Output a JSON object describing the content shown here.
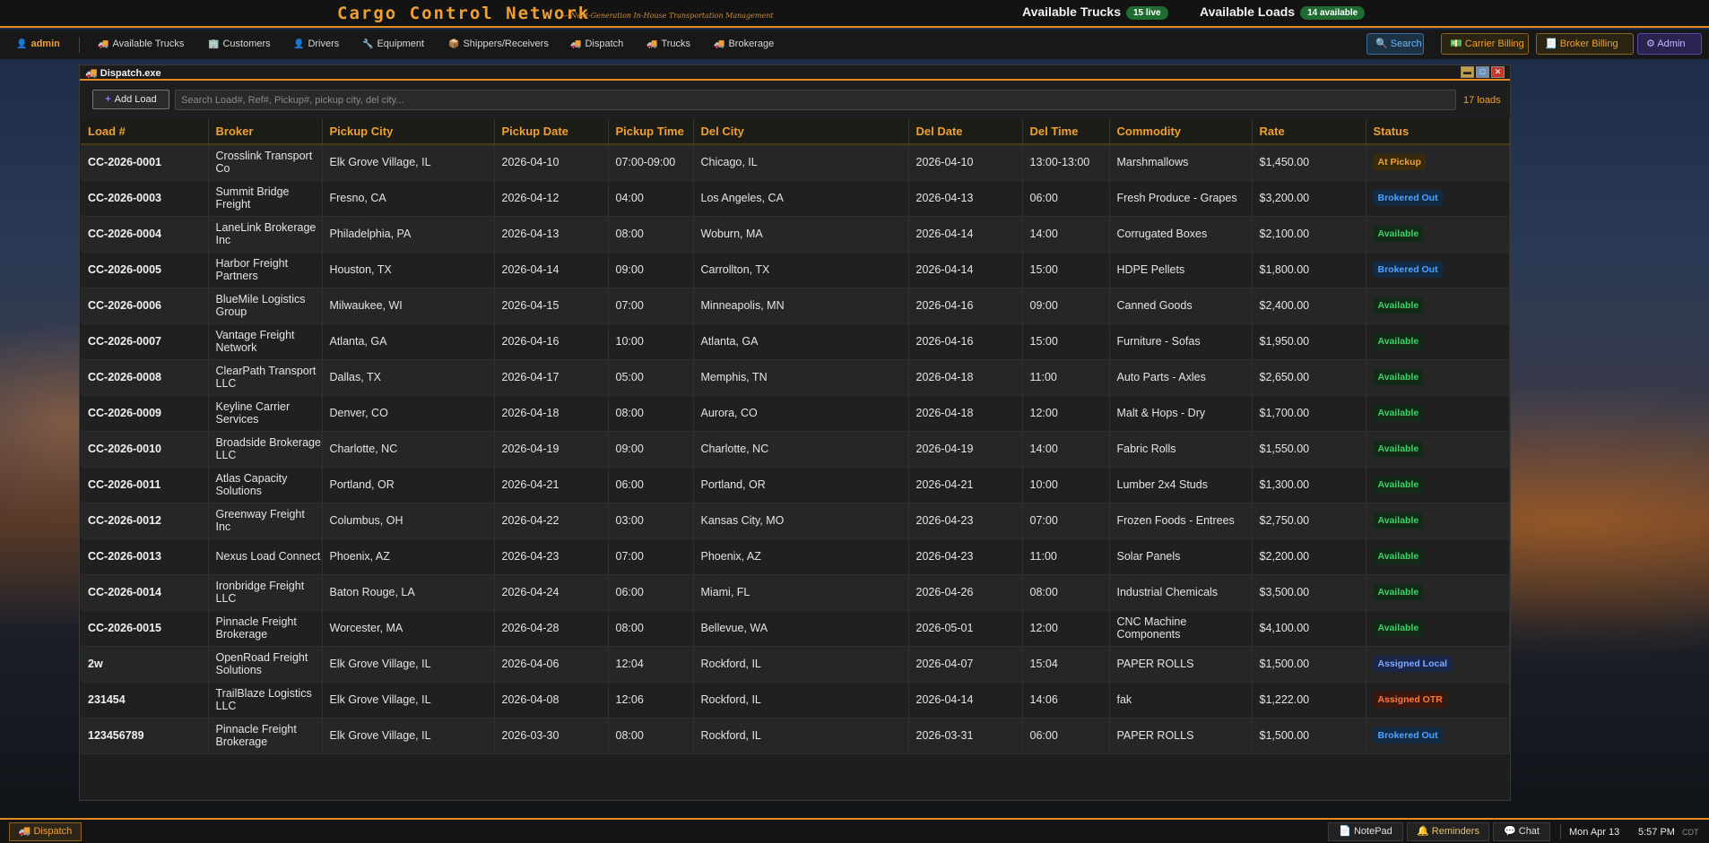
{
  "header": {
    "title": "Cargo Control Network",
    "tagline": "— Next-Generation In-House Transportation Management",
    "available_trucks_label": "Available Trucks",
    "available_trucks_badge": "15 live",
    "available_loads_label": "Available Loads",
    "available_loads_badge": "14 available"
  },
  "nav": {
    "user": "admin",
    "items": [
      {
        "label": "Available Trucks",
        "icon": "truck-icon"
      },
      {
        "label": "Customers",
        "icon": "building-icon"
      },
      {
        "label": "Drivers",
        "icon": "person-icon"
      },
      {
        "label": "Equipment",
        "icon": "wrench-icon"
      },
      {
        "label": "Shippers/Receivers",
        "icon": "box-icon"
      },
      {
        "label": "Dispatch",
        "icon": "truck-icon"
      },
      {
        "label": "Trucks",
        "icon": "truck-icon"
      },
      {
        "label": "Brokerage",
        "icon": "truck-icon"
      }
    ],
    "right_buttons": {
      "search": "Search",
      "carrier_billing": "Carrier Billing",
      "broker_billing": "Broker Billing",
      "admin": "Admin"
    }
  },
  "window": {
    "title": "Dispatch.exe",
    "add_load_label": "Add Load",
    "search_placeholder": "Search Load#, Ref#, Pickup#, pickup city, del city...",
    "load_count": "17 loads",
    "columns": [
      "Load #",
      "Broker",
      "Pickup City",
      "Pickup Date",
      "Pickup Time",
      "Del City",
      "Del Date",
      "Del Time",
      "Commodity",
      "Rate",
      "Status"
    ],
    "rows": [
      {
        "load": "CC-2026-0001",
        "broker": "Crosslink Transport Co",
        "pickup_city": "Elk Grove Village, IL",
        "pickup_date": "2026-04-10",
        "pickup_time": "07:00-09:00",
        "del_city": "Chicago, IL",
        "del_date": "2026-04-10",
        "del_time": "13:00-13:00",
        "commodity": "Marshmallows",
        "rate": "$1,450.00",
        "status": "At Pickup",
        "status_class": "st-pickup"
      },
      {
        "load": "CC-2026-0003",
        "broker": "Summit Bridge Freight",
        "pickup_city": "Fresno, CA",
        "pickup_date": "2026-04-12",
        "pickup_time": "04:00",
        "del_city": "Los Angeles, CA",
        "del_date": "2026-04-13",
        "del_time": "06:00",
        "commodity": "Fresh Produce - Grapes",
        "rate": "$3,200.00",
        "status": "Brokered Out",
        "status_class": "st-brokered"
      },
      {
        "load": "CC-2026-0004",
        "broker": "LaneLink Brokerage Inc",
        "pickup_city": "Philadelphia, PA",
        "pickup_date": "2026-04-13",
        "pickup_time": "08:00",
        "del_city": "Woburn, MA",
        "del_date": "2026-04-14",
        "del_time": "14:00",
        "commodity": "Corrugated Boxes",
        "rate": "$2,100.00",
        "status": "Available",
        "status_class": "st-available"
      },
      {
        "load": "CC-2026-0005",
        "broker": "Harbor Freight Partners",
        "pickup_city": "Houston, TX",
        "pickup_date": "2026-04-14",
        "pickup_time": "09:00",
        "del_city": "Carrollton, TX",
        "del_date": "2026-04-14",
        "del_time": "15:00",
        "commodity": "HDPE Pellets",
        "rate": "$1,800.00",
        "status": "Brokered Out",
        "status_class": "st-brokered"
      },
      {
        "load": "CC-2026-0006",
        "broker": "BlueMile Logistics Group",
        "pickup_city": "Milwaukee, WI",
        "pickup_date": "2026-04-15",
        "pickup_time": "07:00",
        "del_city": "Minneapolis, MN",
        "del_date": "2026-04-16",
        "del_time": "09:00",
        "commodity": "Canned Goods",
        "rate": "$2,400.00",
        "status": "Available",
        "status_class": "st-available"
      },
      {
        "load": "CC-2026-0007",
        "broker": "Vantage Freight Network",
        "pickup_city": "Atlanta, GA",
        "pickup_date": "2026-04-16",
        "pickup_time": "10:00",
        "del_city": "Atlanta, GA",
        "del_date": "2026-04-16",
        "del_time": "15:00",
        "commodity": "Furniture - Sofas",
        "rate": "$1,950.00",
        "status": "Available",
        "status_class": "st-available"
      },
      {
        "load": "CC-2026-0008",
        "broker": "ClearPath Transport LLC",
        "pickup_city": "Dallas, TX",
        "pickup_date": "2026-04-17",
        "pickup_time": "05:00",
        "del_city": "Memphis, TN",
        "del_date": "2026-04-18",
        "del_time": "11:00",
        "commodity": "Auto Parts - Axles",
        "rate": "$2,650.00",
        "status": "Available",
        "status_class": "st-available"
      },
      {
        "load": "CC-2026-0009",
        "broker": "Keyline Carrier Services",
        "pickup_city": "Denver, CO",
        "pickup_date": "2026-04-18",
        "pickup_time": "08:00",
        "del_city": "Aurora, CO",
        "del_date": "2026-04-18",
        "del_time": "12:00",
        "commodity": "Malt & Hops - Dry",
        "rate": "$1,700.00",
        "status": "Available",
        "status_class": "st-available"
      },
      {
        "load": "CC-2026-0010",
        "broker": "Broadside Brokerage LLC",
        "pickup_city": "Charlotte, NC",
        "pickup_date": "2026-04-19",
        "pickup_time": "09:00",
        "del_city": "Charlotte, NC",
        "del_date": "2026-04-19",
        "del_time": "14:00",
        "commodity": "Fabric Rolls",
        "rate": "$1,550.00",
        "status": "Available",
        "status_class": "st-available"
      },
      {
        "load": "CC-2026-0011",
        "broker": "Atlas Capacity Solutions",
        "pickup_city": "Portland, OR",
        "pickup_date": "2026-04-21",
        "pickup_time": "06:00",
        "del_city": "Portland, OR",
        "del_date": "2026-04-21",
        "del_time": "10:00",
        "commodity": "Lumber 2x4 Studs",
        "rate": "$1,300.00",
        "status": "Available",
        "status_class": "st-available"
      },
      {
        "load": "CC-2026-0012",
        "broker": "Greenway Freight Inc",
        "pickup_city": "Columbus, OH",
        "pickup_date": "2026-04-22",
        "pickup_time": "03:00",
        "del_city": "Kansas City, MO",
        "del_date": "2026-04-23",
        "del_time": "07:00",
        "commodity": "Frozen Foods - Entrees",
        "rate": "$2,750.00",
        "status": "Available",
        "status_class": "st-available"
      },
      {
        "load": "CC-2026-0013",
        "broker": "Nexus Load Connect",
        "pickup_city": "Phoenix, AZ",
        "pickup_date": "2026-04-23",
        "pickup_time": "07:00",
        "del_city": "Phoenix, AZ",
        "del_date": "2026-04-23",
        "del_time": "11:00",
        "commodity": "Solar Panels",
        "rate": "$2,200.00",
        "status": "Available",
        "status_class": "st-available"
      },
      {
        "load": "CC-2026-0014",
        "broker": "Ironbridge Freight LLC",
        "pickup_city": "Baton Rouge, LA",
        "pickup_date": "2026-04-24",
        "pickup_time": "06:00",
        "del_city": "Miami, FL",
        "del_date": "2026-04-26",
        "del_time": "08:00",
        "commodity": "Industrial Chemicals",
        "rate": "$3,500.00",
        "status": "Available",
        "status_class": "st-available"
      },
      {
        "load": "CC-2026-0015",
        "broker": "Pinnacle Freight Brokerage",
        "pickup_city": "Worcester, MA",
        "pickup_date": "2026-04-28",
        "pickup_time": "08:00",
        "del_city": "Bellevue, WA",
        "del_date": "2026-05-01",
        "del_time": "12:00",
        "commodity": "CNC Machine Components",
        "rate": "$4,100.00",
        "status": "Available",
        "status_class": "st-available"
      },
      {
        "load": "2w",
        "broker": "OpenRoad Freight Solutions",
        "pickup_city": "Elk Grove Village, IL",
        "pickup_date": "2026-04-06",
        "pickup_time": "12:04",
        "del_city": "Rockford, IL",
        "del_date": "2026-04-07",
        "del_time": "15:04",
        "commodity": "PAPER ROLLS",
        "rate": "$1,500.00",
        "status": "Assigned Local",
        "status_class": "st-local"
      },
      {
        "load": "231454",
        "broker": "TrailBlaze Logistics LLC",
        "pickup_city": "Elk Grove Village, IL",
        "pickup_date": "2026-04-08",
        "pickup_time": "12:06",
        "del_city": "Rockford, IL",
        "del_date": "2026-04-14",
        "del_time": "14:06",
        "commodity": "fak",
        "rate": "$1,222.00",
        "status": "Assigned OTR",
        "status_class": "st-otr"
      },
      {
        "load": "123456789",
        "broker": "Pinnacle Freight Brokerage",
        "pickup_city": "Elk Grove Village, IL",
        "pickup_date": "2026-03-30",
        "pickup_time": "08:00",
        "del_city": "Rockford, IL",
        "del_date": "2026-03-31",
        "del_time": "06:00",
        "commodity": "PAPER ROLLS",
        "rate": "$1,500.00",
        "status": "Brokered Out",
        "status_class": "st-brokered"
      }
    ]
  },
  "taskbar": {
    "active_app": "Dispatch",
    "notepad": "NotePad",
    "reminders": "Reminders",
    "chat": "Chat",
    "date": "Mon Apr 13",
    "time": "5:57 PM",
    "timezone": "CDT"
  },
  "colors": {
    "accent": "#e58a1f",
    "available": "#3ed36a",
    "brokered": "#4fa3ff",
    "at_pickup": "#f0a030",
    "assigned_otr": "#ff7a3a"
  }
}
